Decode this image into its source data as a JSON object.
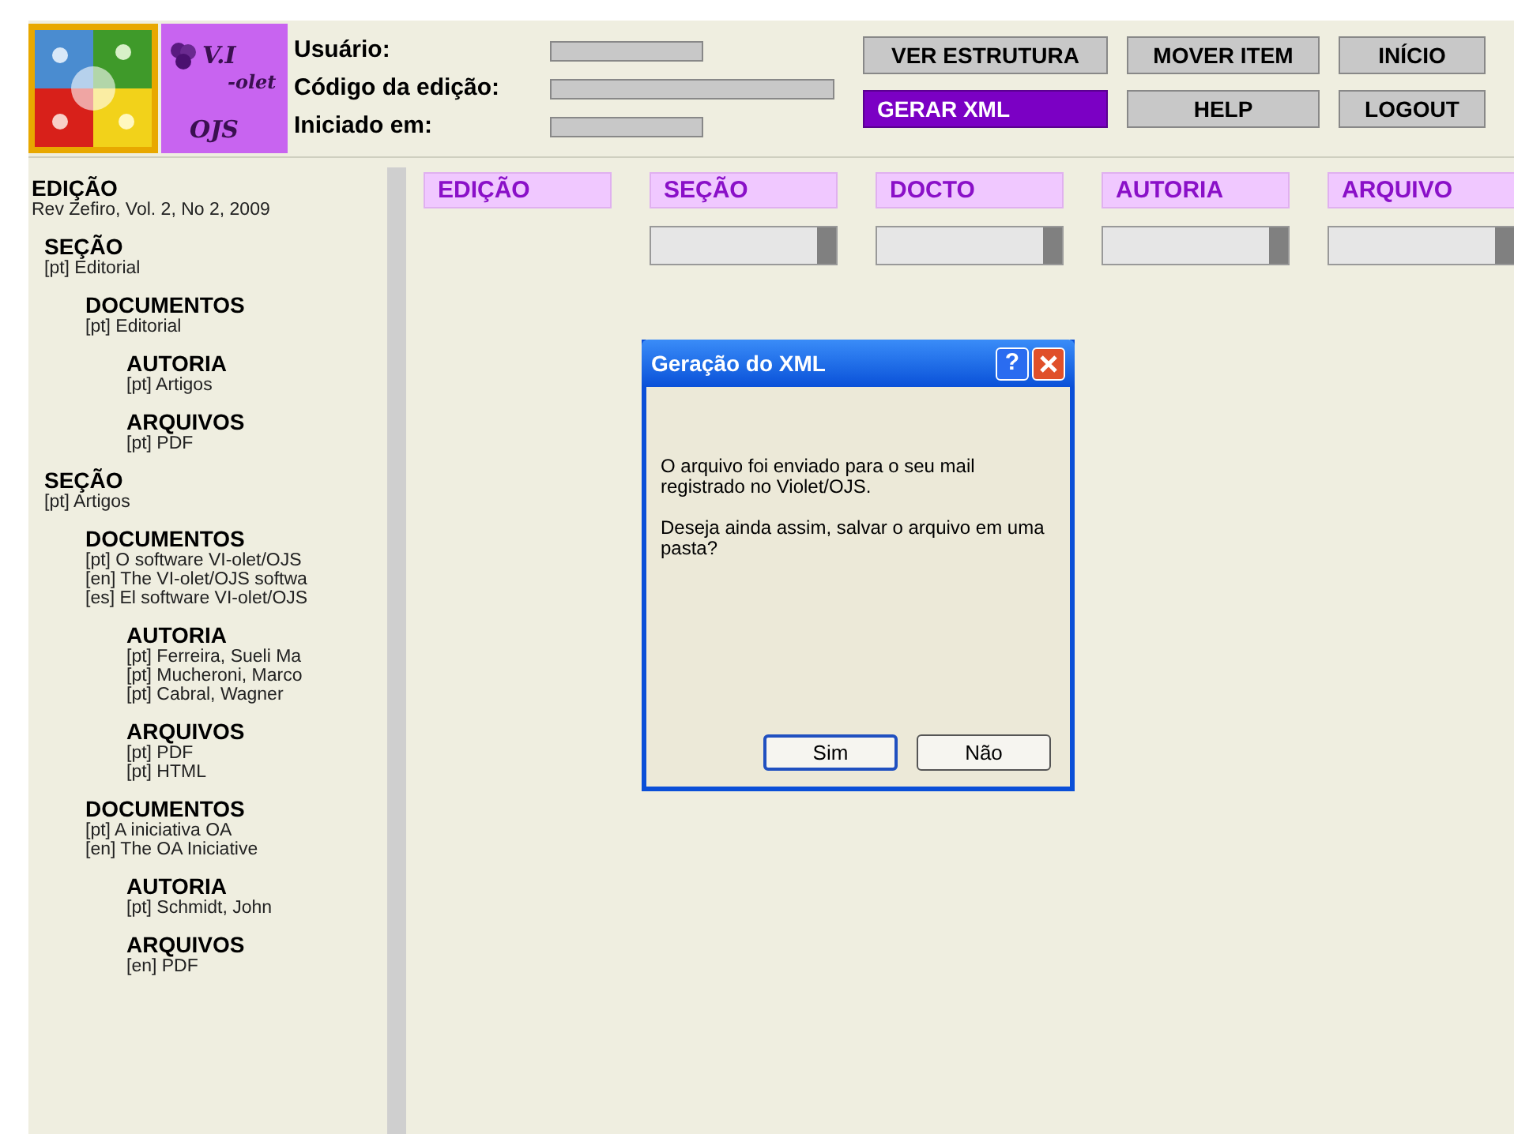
{
  "header": {
    "logo_text": [
      "V.I",
      "-olet",
      "OJS"
    ],
    "fields": [
      {
        "label": "Usuário:",
        "kind": "short"
      },
      {
        "label": "Código da edição:",
        "kind": "long"
      },
      {
        "label": "Iniciado em:",
        "kind": "short"
      }
    ],
    "buttons": [
      {
        "label": "VER ESTRUTURA",
        "selected": false
      },
      {
        "label": "MOVER ITEM",
        "selected": false
      },
      {
        "label": "INÍCIO",
        "selected": false
      },
      {
        "label": "GERAR XML",
        "selected": true
      },
      {
        "label": "HELP",
        "selected": false
      },
      {
        "label": "LOGOUT",
        "selected": false
      }
    ]
  },
  "tree": [
    {
      "label": "EDIÇÃO",
      "items": [
        "Rev Zefiro, Vol. 2, No 2, 2009"
      ],
      "children": [
        {
          "label": "SEÇÃO",
          "items": [
            "[pt] Editorial"
          ],
          "children": [
            {
              "label": "DOCUMENTOS",
              "items": [
                "[pt] Editorial"
              ],
              "children": [
                {
                  "label": "AUTORIA",
                  "items": [
                    "[pt] Artigos"
                  ]
                },
                {
                  "label": "ARQUIVOS",
                  "items": [
                    "[pt] PDF"
                  ]
                }
              ]
            }
          ]
        },
        {
          "label": "SEÇÃO",
          "items": [
            "[pt] Artigos"
          ],
          "children": [
            {
              "label": "DOCUMENTOS",
              "items": [
                "[pt] O software VI-olet/OJS",
                "[en] The VI-olet/OJS softwa",
                "[es] El software VI-olet/OJS"
              ],
              "children": [
                {
                  "label": "AUTORIA",
                  "items": [
                    "[pt] Ferreira, Sueli Ma",
                    "[pt] Mucheroni, Marco",
                    "[pt] Cabral, Wagner"
                  ]
                },
                {
                  "label": "ARQUIVOS",
                  "items": [
                    "[pt] PDF",
                    "[pt] HTML"
                  ]
                }
              ]
            },
            {
              "label": "DOCUMENTOS",
              "items": [
                "[pt] A iniciativa OA",
                "[en] The OA Iniciative"
              ],
              "children": [
                {
                  "label": "AUTORIA",
                  "items": [
                    "[pt] Schmidt, John"
                  ]
                },
                {
                  "label": "ARQUIVOS",
                  "items": [
                    "[en] PDF"
                  ]
                }
              ]
            }
          ]
        }
      ]
    }
  ],
  "columns": [
    {
      "label": "EDIÇÃO",
      "dropdown": false
    },
    {
      "label": "SEÇÃO",
      "dropdown": true
    },
    {
      "label": "DOCTO",
      "dropdown": true
    },
    {
      "label": "AUTORIA",
      "dropdown": true
    },
    {
      "label": "ARQUIVO",
      "dropdown": true
    }
  ],
  "dialog": {
    "title": "Geração do XML",
    "help": "?",
    "paragraphs": [
      "O arquivo foi enviado para o seu mail registrado no Violet/OJS.",
      "Deseja ainda assim, salvar o arquivo em uma pasta?"
    ],
    "buttons": [
      {
        "label": "Sim",
        "selected": true
      },
      {
        "label": "Não",
        "selected": false
      }
    ]
  }
}
